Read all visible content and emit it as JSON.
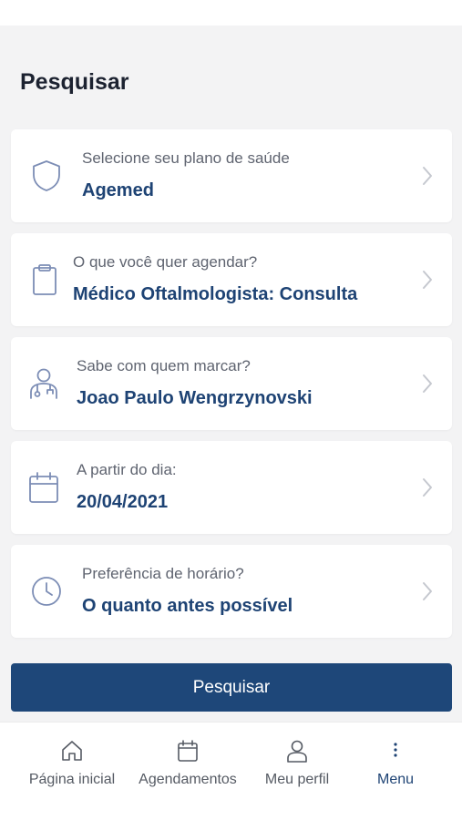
{
  "page": {
    "title": "Pesquisar"
  },
  "fields": [
    {
      "label": "Selecione seu plano de saúde",
      "value": "Agemed",
      "icon": "shield-icon"
    },
    {
      "label": "O que você quer agendar?",
      "value": "Médico Oftalmologista: Consulta",
      "icon": "clipboard-icon"
    },
    {
      "label": "Sabe com quem marcar?",
      "value": "Joao Paulo Wengrzynovski",
      "icon": "doctor-icon"
    },
    {
      "label": "A partir do dia:",
      "value": "20/04/2021",
      "icon": "calendar-icon"
    },
    {
      "label": "Preferência de horário?",
      "value": "O quanto antes possível",
      "icon": "clock-icon"
    }
  ],
  "search_button": {
    "label": "Pesquisar"
  },
  "bottom_nav": {
    "items": [
      {
        "label": "Página inicial",
        "icon": "home-icon"
      },
      {
        "label": "Agendamentos",
        "icon": "calendar-icon"
      },
      {
        "label": "Meu perfil",
        "icon": "user-icon"
      },
      {
        "label": "Menu",
        "icon": "more-vertical-icon",
        "active": true
      }
    ]
  },
  "colors": {
    "accent": "#1e4779",
    "value_text": "#1e4374",
    "label_text": "#5f6470",
    "background": "#f3f3f4",
    "icon_stroke": "#7c8db5"
  }
}
